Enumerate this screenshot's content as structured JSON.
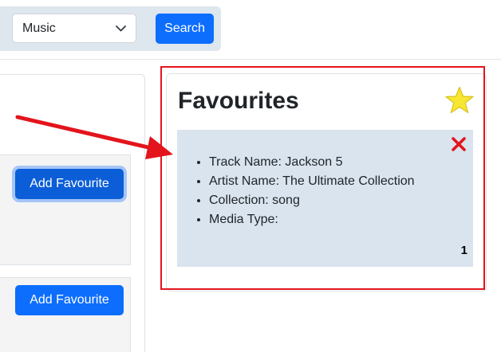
{
  "search": {
    "media_type_value": "Music",
    "search_label": "Search"
  },
  "results": {
    "add_favourite_label": "Add Favourite"
  },
  "favourites": {
    "title": "Favourites",
    "items": [
      {
        "track_name": "Track Name: Jackson 5",
        "artist_name": "Artist Name: The Ultimate Collection",
        "collection": "Collection: song",
        "media_type": "Media Type:",
        "index": "1"
      }
    ]
  },
  "colors": {
    "primary": "#0d6efd",
    "annotation_red": "#e3141c",
    "star_yellow": "#f7e632",
    "item_bg": "#d9e4ef"
  },
  "icons": [
    "chevron-down-icon",
    "star-icon",
    "close-icon"
  ]
}
